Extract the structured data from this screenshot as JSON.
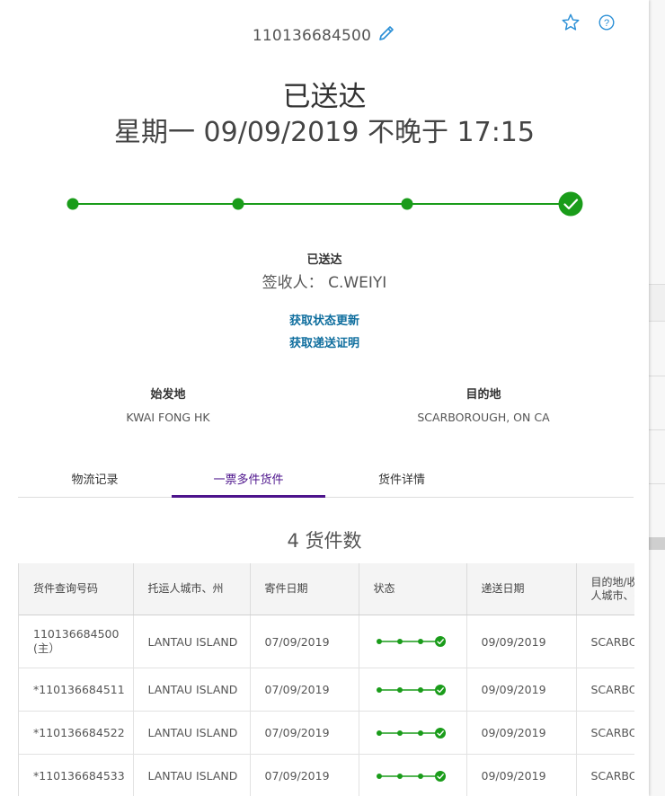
{
  "header": {
    "tracking_number": "110136684500"
  },
  "status": {
    "title": "已送达",
    "date_line": "星期一 09/09/2019 不晚于 17:15",
    "sub_status": "已送达",
    "signed_by": "签收人： C.WEIYI",
    "progress_steps_completed": 4,
    "progress_steps_total": 4
  },
  "links": {
    "get_updates": "获取状态更新",
    "proof_of_delivery": "获取递送证明"
  },
  "locations": {
    "origin_label": "始发地",
    "origin_value": "KWAI FONG HK",
    "destination_label": "目的地",
    "destination_value": "SCARBOROUGH, ON CA"
  },
  "tabs": [
    {
      "label": "物流记录"
    },
    {
      "label": "一票多件货件",
      "active": true
    },
    {
      "label": "货件详情"
    }
  ],
  "shipment_count": "4 货件数",
  "table": {
    "headers": [
      "货件查询号码",
      "托运人城市、州",
      "寄件日期",
      "状态",
      "递送日期",
      "目的地/收件人城市、州"
    ],
    "rows": [
      {
        "tracking": "110136684500 (主）",
        "city": "LANTAU ISLAND",
        "ship_date": "07/09/2019",
        "delivery_date": "09/09/2019",
        "dest": "SCARBOROUGH, ON"
      },
      {
        "tracking": "*110136684511",
        "city": "LANTAU ISLAND",
        "ship_date": "07/09/2019",
        "delivery_date": "09/09/2019",
        "dest": "SCARBOROUGH, ON"
      },
      {
        "tracking": "*110136684522",
        "city": "LANTAU ISLAND",
        "ship_date": "07/09/2019",
        "delivery_date": "09/09/2019",
        "dest": "SCARBOROUGH, ON"
      },
      {
        "tracking": "*110136684533",
        "city": "LANTAU ISLAND",
        "ship_date": "07/09/2019",
        "delivery_date": "09/09/2019",
        "dest": "SCARBOROUGH, ON"
      }
    ]
  },
  "colors": {
    "progress_green": "#1a9c1a",
    "accent_purple": "#4d148c",
    "link_blue": "#0f6e9e",
    "icon_blue": "#2a8fd6"
  },
  "icons": [
    "pencil-icon",
    "star-icon",
    "help-icon",
    "checkmark-icon"
  ]
}
